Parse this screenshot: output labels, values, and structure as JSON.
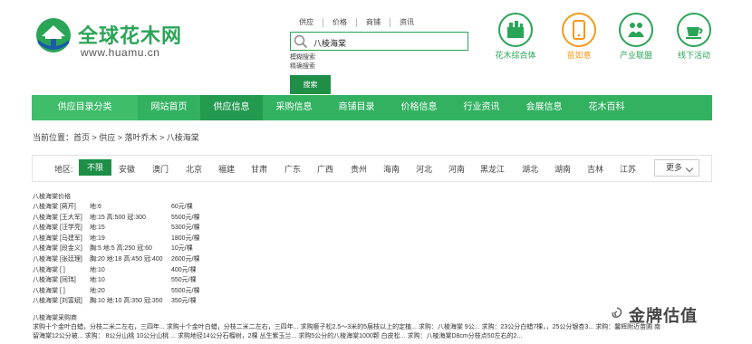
{
  "logo": {
    "name": "全球花木网",
    "url": "www.huamu.cn"
  },
  "search": {
    "tabs": [
      "供应",
      "价格",
      "商铺",
      "资讯"
    ],
    "value": "八棱海棠",
    "options": [
      "模糊搜索",
      "精确搜索"
    ],
    "button": "搜索"
  },
  "quick_links": [
    "花木综合体",
    "苗如意",
    "产业联盟",
    "线下活动"
  ],
  "nav": [
    "供应目录分类",
    "网站首页",
    "供应信息",
    "采购信息",
    "商铺目录",
    "价格信息",
    "行业资讯",
    "会展信息",
    "花木百科"
  ],
  "breadcrumb": "当前位置：首页 > 供应 > 落叶乔木 > 八棱海棠",
  "region": {
    "label": "地区:",
    "selected": "不限",
    "items": [
      "安徽",
      "澳门",
      "北京",
      "福建",
      "甘肃",
      "广东",
      "广西",
      "贵州",
      "海南",
      "河北",
      "河南",
      "黑龙江",
      "湖北",
      "湖南",
      "吉林",
      "江苏"
    ],
    "more": "更多"
  },
  "price_section": {
    "title": "八棱海棠价格",
    "rows": [
      {
        "name": "八棱海棠 [蒋芹]",
        "spec": "地:6",
        "price": "60元/棵"
      },
      {
        "name": "八棱海棠 [王大军]",
        "spec": "地:15 高:500 冠:300",
        "price": "5500元/棵"
      },
      {
        "name": "八棱海棠 [汪学亮]",
        "spec": "地:15",
        "price": "5300元/棵"
      },
      {
        "name": "八棱海棠 [马建军]",
        "spec": "地:19",
        "price": "1800元/棵"
      },
      {
        "name": "八棱海棠 [段金义]",
        "spec": "胸:5 地:5 高:250 冠:60",
        "price": "10元/棵"
      },
      {
        "name": "八棱海棠 [张廷理]",
        "spec": "胸:20 地:18 高:450 冠:400",
        "price": "2600元/棵"
      },
      {
        "name": "八棱海棠 [ ]",
        "spec": "地:10",
        "price": "400元/棵"
      },
      {
        "name": "八棱海棠 [同玮]",
        "spec": "地:10",
        "price": "550元/棵"
      },
      {
        "name": "八棱海棠 [ ]",
        "spec": "地:20",
        "price": "5500元/棵"
      },
      {
        "name": "八棱海棠 [刘富斌]",
        "spec": "胸:10 地:10 高:350 冠:350",
        "price": "350元/棵"
      }
    ]
  },
  "purchase_section": {
    "title": "八棱海棠采购商",
    "line1": "求购十个金叶白蜡，分枝二米二左右，三四年... 求购十个金叶白蜡，分枝二米二左右，三四年... 求购榧子松2.5～3米的5层枝以上的定植... 求购：八棱海棠 9公... 求购：23公分白蜡7棵，，25公分银杏3... 求购：馨辉附近苗圃 南",
    "line2": "留海棠12公分被... 求购： 8公分山桃 10公分山桃 ... 求购地径14公分石榴树，2棵 丛生紫玉兰... 求购5公分的八棱海棠1000颗 白皮松... 求购：八棱海棠D8cm分枝点50左右的2..."
  },
  "watermark": "金牌估值"
}
